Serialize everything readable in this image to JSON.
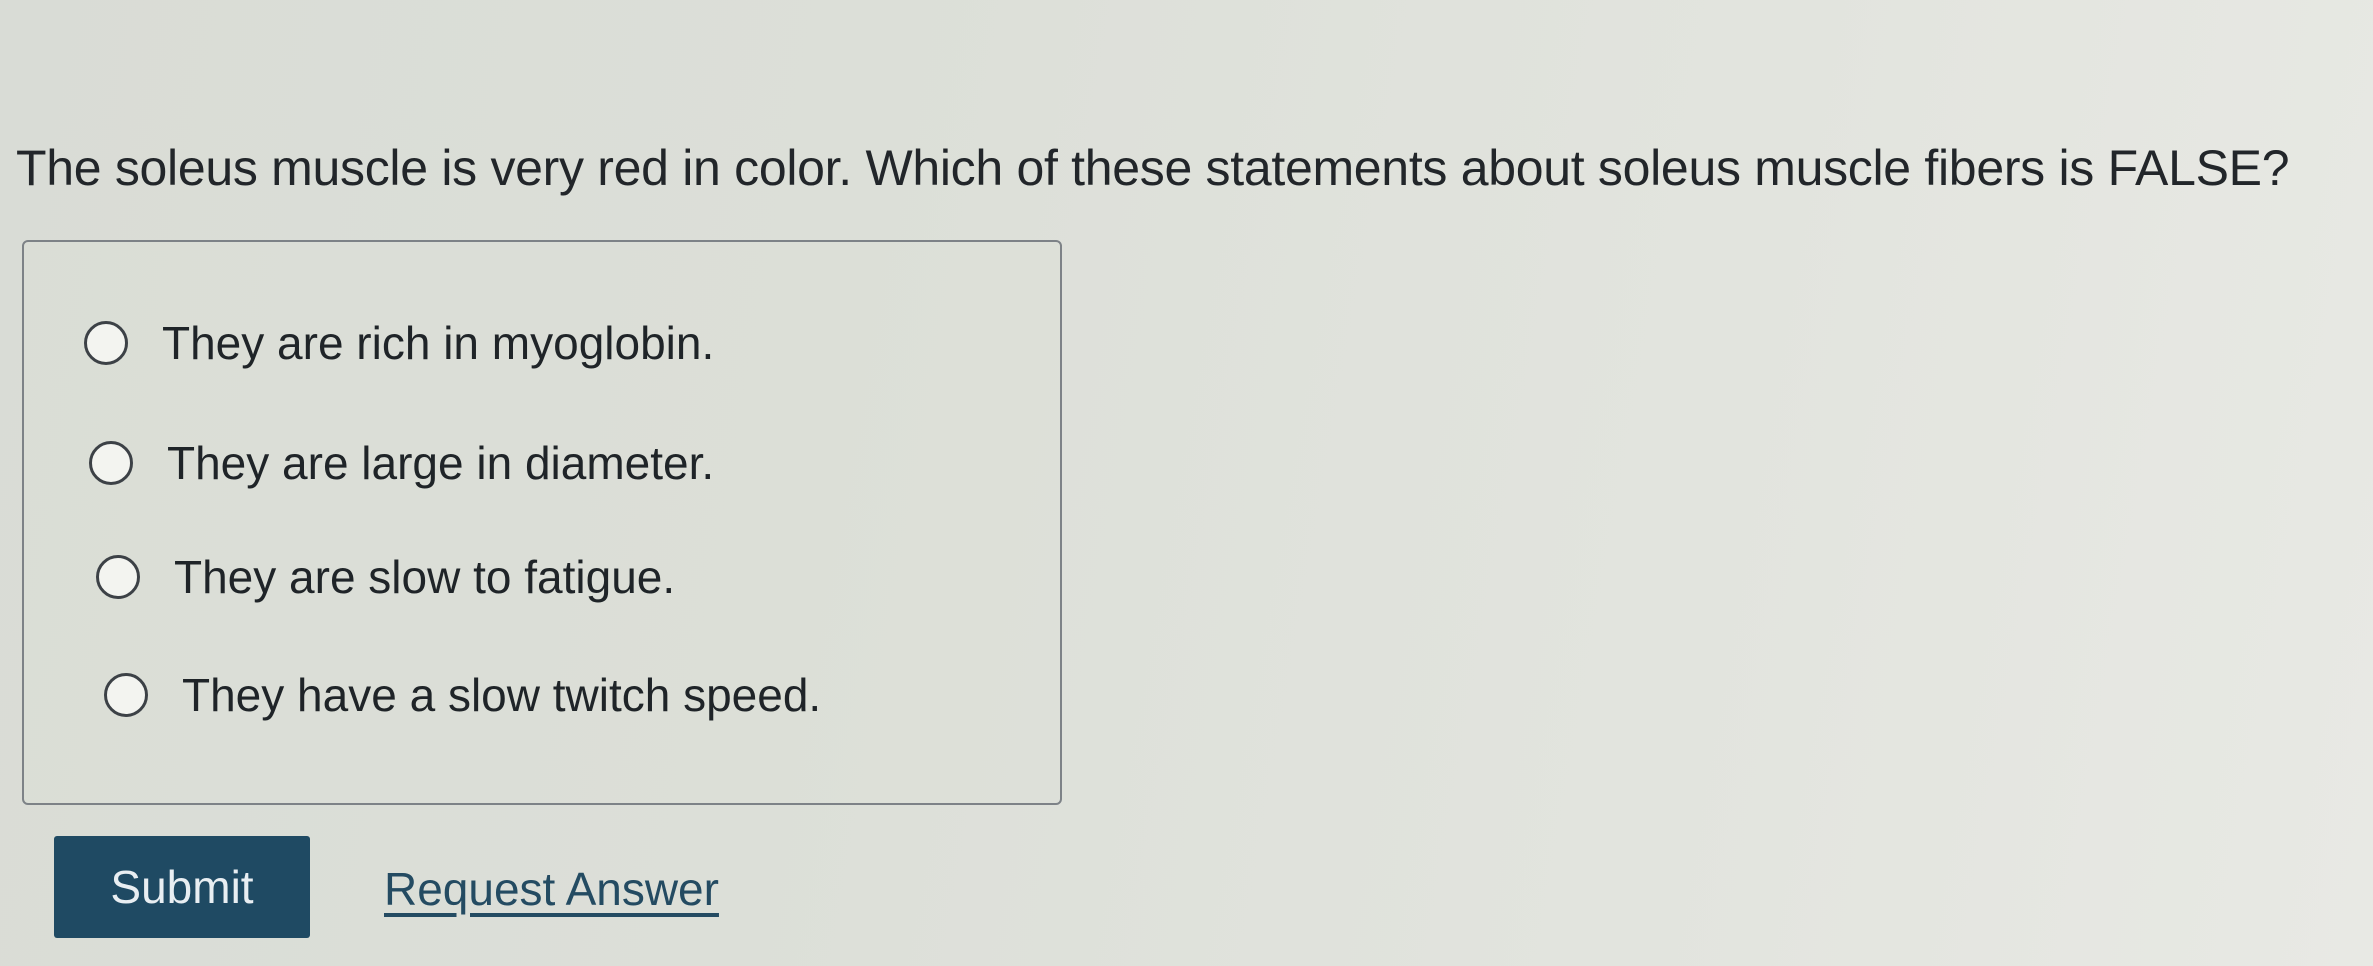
{
  "question": {
    "text": "The soleus muscle is very red in color. Which of these statements about soleus muscle fibers is FALSE?"
  },
  "options": [
    {
      "label": "They are rich in myoglobin.",
      "selected": false
    },
    {
      "label": "They are large in diameter.",
      "selected": false
    },
    {
      "label": "They are slow to fatigue.",
      "selected": false
    },
    {
      "label": "They have a slow twitch speed.",
      "selected": false
    }
  ],
  "actions": {
    "submit_label": "Submit",
    "request_answer_label": "Request Answer"
  },
  "colors": {
    "submit_bg": "#1f4a63",
    "link": "#244b62"
  }
}
